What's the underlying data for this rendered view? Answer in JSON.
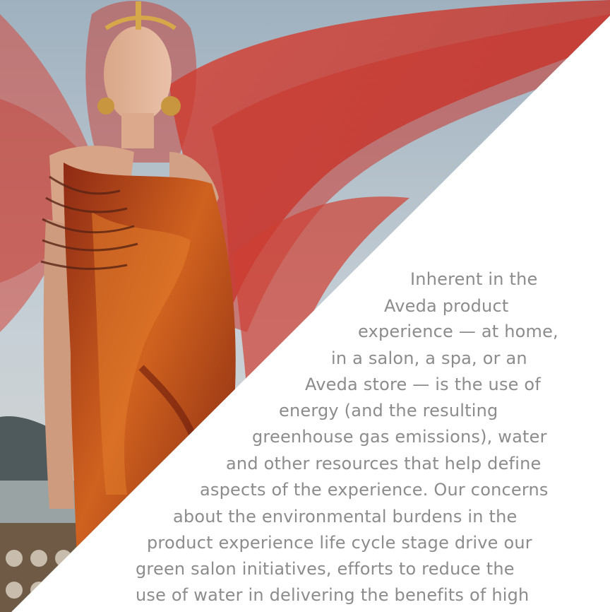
{
  "image": {
    "subject": "photo-woman-red-veil",
    "colors": {
      "sky": "#b9c6cf",
      "fabric_red": "#c9302a",
      "dress_orange": "#c4551c",
      "skin": "#e3b49a",
      "text_gray": "#8c8c8c",
      "background": "#ffffff"
    }
  },
  "body_text": {
    "lines": [
      "Inherent in the",
      "Aveda product",
      "experience — at home,",
      "in a salon, a spa, or an",
      "Aveda store — is the use of",
      "energy (and the resulting",
      "greenhouse gas emissions), water",
      "and other resources that help define",
      "aspects of the experience. Our concerns",
      "about the environmental burdens in the",
      "product experience life cycle stage drive our",
      "green salon initiatives, efforts to reduce the",
      "use of water in delivering the benefits of high"
    ]
  }
}
